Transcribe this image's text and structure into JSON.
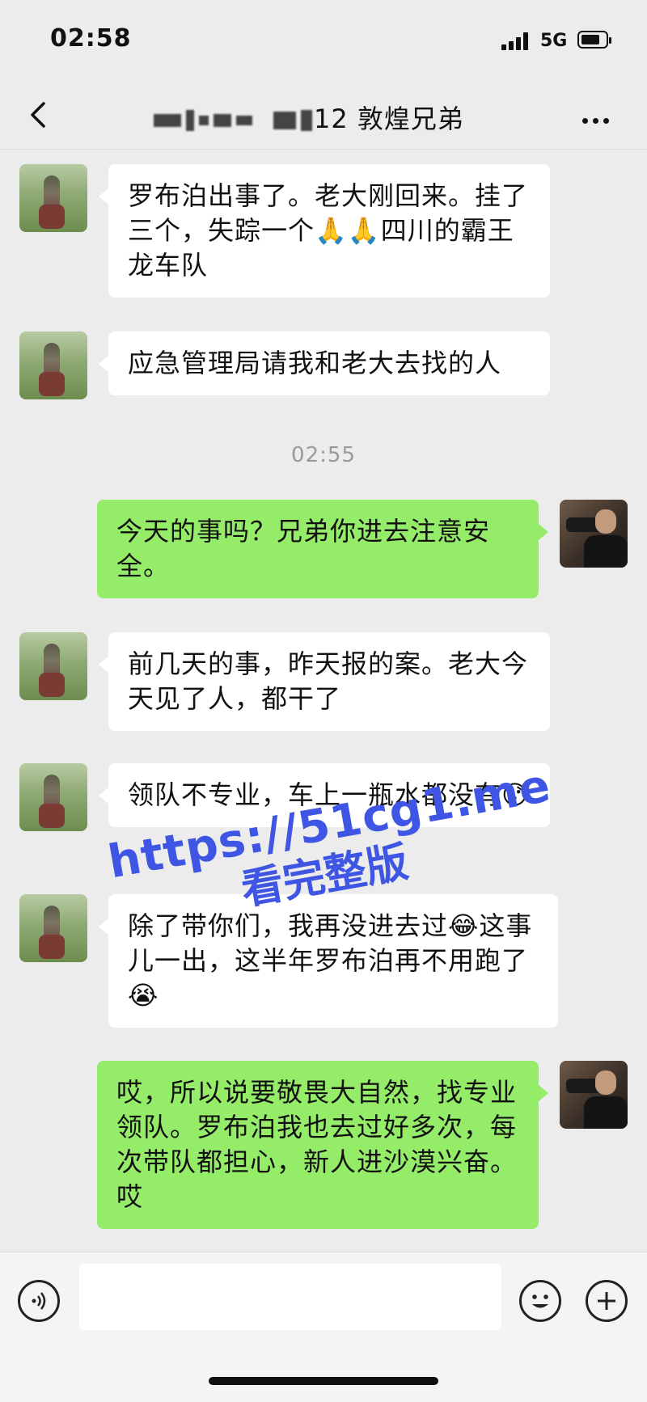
{
  "status_bar": {
    "time": "02:58",
    "network": "5G"
  },
  "nav": {
    "title": "12 敦煌兄弟",
    "back_icon": "chevron-left-icon",
    "more_icon": "more-dots-icon"
  },
  "messages": [
    {
      "side": "left",
      "text": "罗布泊出事了。老大刚回来。挂了三个，失踪一个🙏🙏四川的霸王龙车队"
    },
    {
      "side": "left",
      "text": "应急管理局请我和老大去找的人"
    },
    {
      "side": "right",
      "text": "今天的事吗？兄弟你进去注意安全。"
    },
    {
      "side": "left",
      "text": "前几天的事，昨天报的案。老大今天见了人，都干了"
    },
    {
      "side": "left",
      "text": "领队不专业，车上一瓶水都没有😯"
    },
    {
      "side": "left",
      "text": "除了带你们，我再没进去过😂这事儿一出，这半年罗布泊再不用跑了😭"
    },
    {
      "side": "right",
      "text": "哎，所以说要敬畏大自然，找专业领队。罗布泊我也去过好多次，每次带队都担心，新人进沙漠兴奋。哎"
    }
  ],
  "timestamp": "02:55",
  "watermark": {
    "line1": "https://51cg1.me",
    "line2": "看完整版"
  },
  "input_bar": {
    "voice_icon": "voice-icon",
    "emoji_icon": "emoji-icon",
    "plus_icon": "plus-icon",
    "input_value": ""
  }
}
